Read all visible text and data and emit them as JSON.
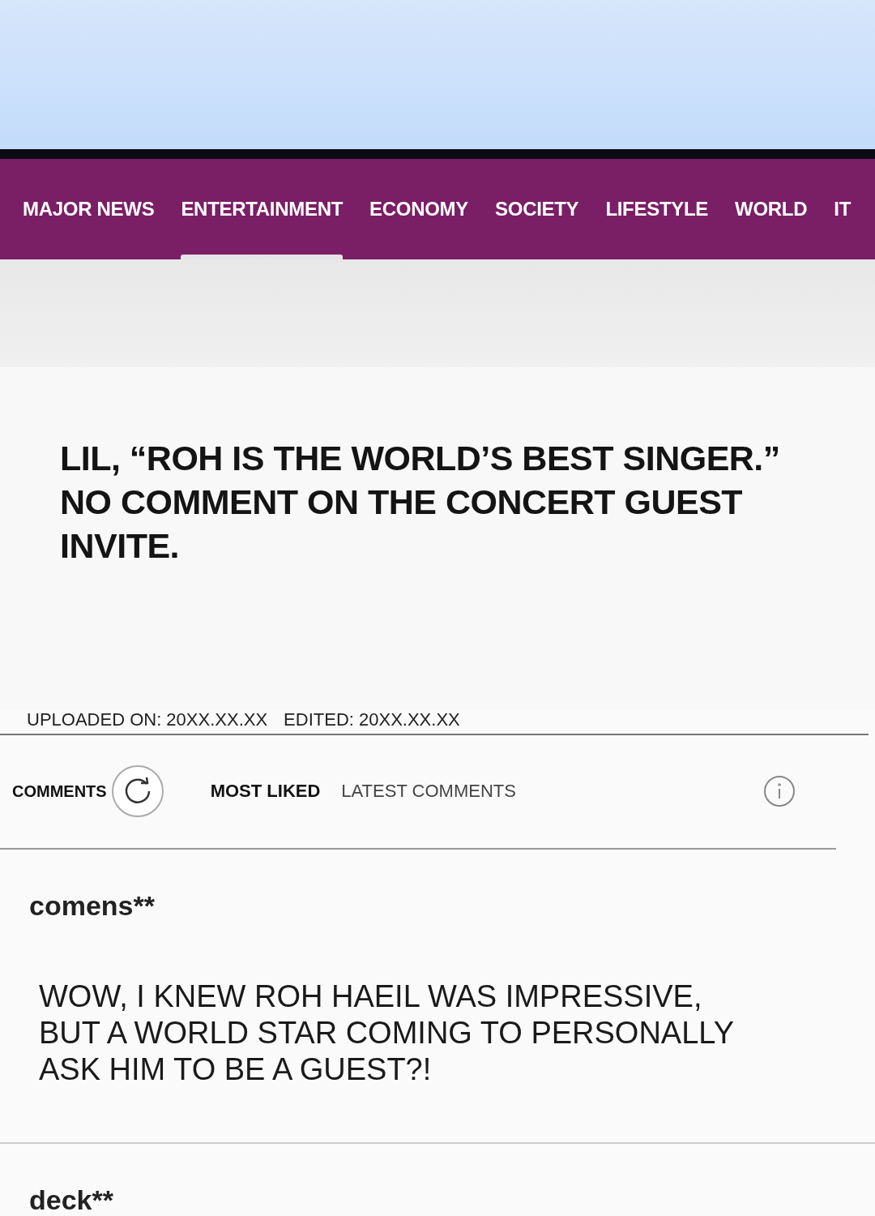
{
  "nav": {
    "items": [
      {
        "label": "MAJOR NEWS",
        "selected": false
      },
      {
        "label": "ENTERTAINMENT",
        "selected": true
      },
      {
        "label": "ECONOMY",
        "selected": false
      },
      {
        "label": "SOCIETY",
        "selected": false
      },
      {
        "label": "LIFESTYLE",
        "selected": false
      },
      {
        "label": "WORLD",
        "selected": false
      },
      {
        "label": "IT",
        "selected": false
      }
    ]
  },
  "article": {
    "headline": "LIL, “ROH IS THE WORLD’S BEST SINGER.” NO COMMENT ON THE CONCERT GUEST INVITE.",
    "uploaded": "UPLOADED ON: 20XX.XX.XX",
    "edited": "EDITED: 20XX.XX.XX"
  },
  "comments": {
    "title": "COMMENTS",
    "sort_tabs": [
      {
        "label": "MOST LIKED",
        "selected": true
      },
      {
        "label": "LATEST COMMENTS",
        "selected": false
      }
    ],
    "items": [
      {
        "author": "comens**",
        "text": "WOW, I KNEW ROH HAEIL WAS IMPRESSIVE, BUT A WORLD STAR COMING TO PERSONALLY ASK HIM TO BE A GUEST?!"
      },
      {
        "author": "deck**"
      }
    ]
  }
}
